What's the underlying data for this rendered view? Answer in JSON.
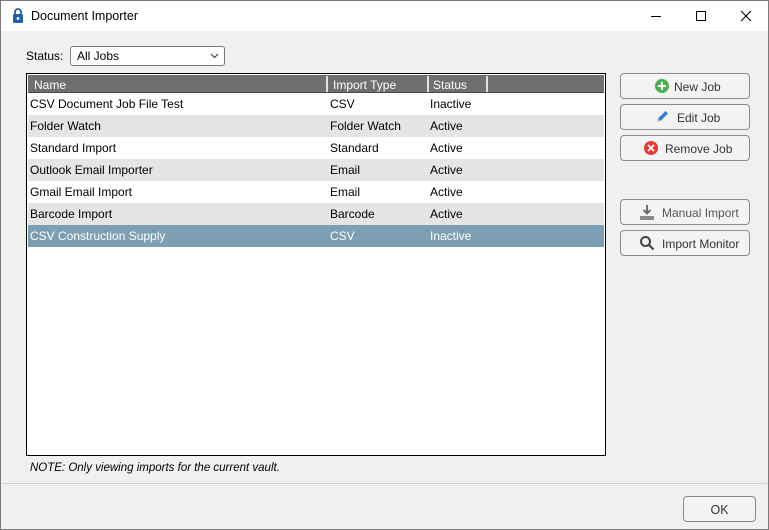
{
  "window": {
    "title": "Document Importer"
  },
  "filter": {
    "label": "Status:",
    "selected": "All Jobs"
  },
  "list": {
    "columns": [
      "Name",
      "Import Type",
      "Status"
    ],
    "rows": [
      {
        "name": "CSV Document Job File Test",
        "type": "CSV",
        "status": "Inactive"
      },
      {
        "name": "Folder Watch",
        "type": "Folder Watch",
        "status": "Active"
      },
      {
        "name": "Standard Import",
        "type": "Standard",
        "status": "Active"
      },
      {
        "name": "Outlook Email Importer",
        "type": "Email",
        "status": "Active"
      },
      {
        "name": "Gmail Email Import",
        "type": "Email",
        "status": "Active"
      },
      {
        "name": "Barcode Import",
        "type": "Barcode",
        "status": "Active"
      },
      {
        "name": "CSV Construction Supply",
        "type": "CSV",
        "status": "Inactive"
      }
    ],
    "selected_index": 6
  },
  "actions": {
    "new_job": "New Job",
    "edit_job": "Edit Job",
    "remove_job": "Remove Job",
    "manual_import": "Manual Import",
    "import_monitor": "Import Monitor"
  },
  "note": "NOTE: Only viewing imports for the current vault.",
  "footer": {
    "ok": "OK"
  },
  "colors": {
    "selection": "#7d9fb4",
    "header": "#6f6f6f",
    "new_icon": "#4caf50",
    "remove_icon": "#e53935",
    "edit_icon": "#2f7fd8"
  }
}
